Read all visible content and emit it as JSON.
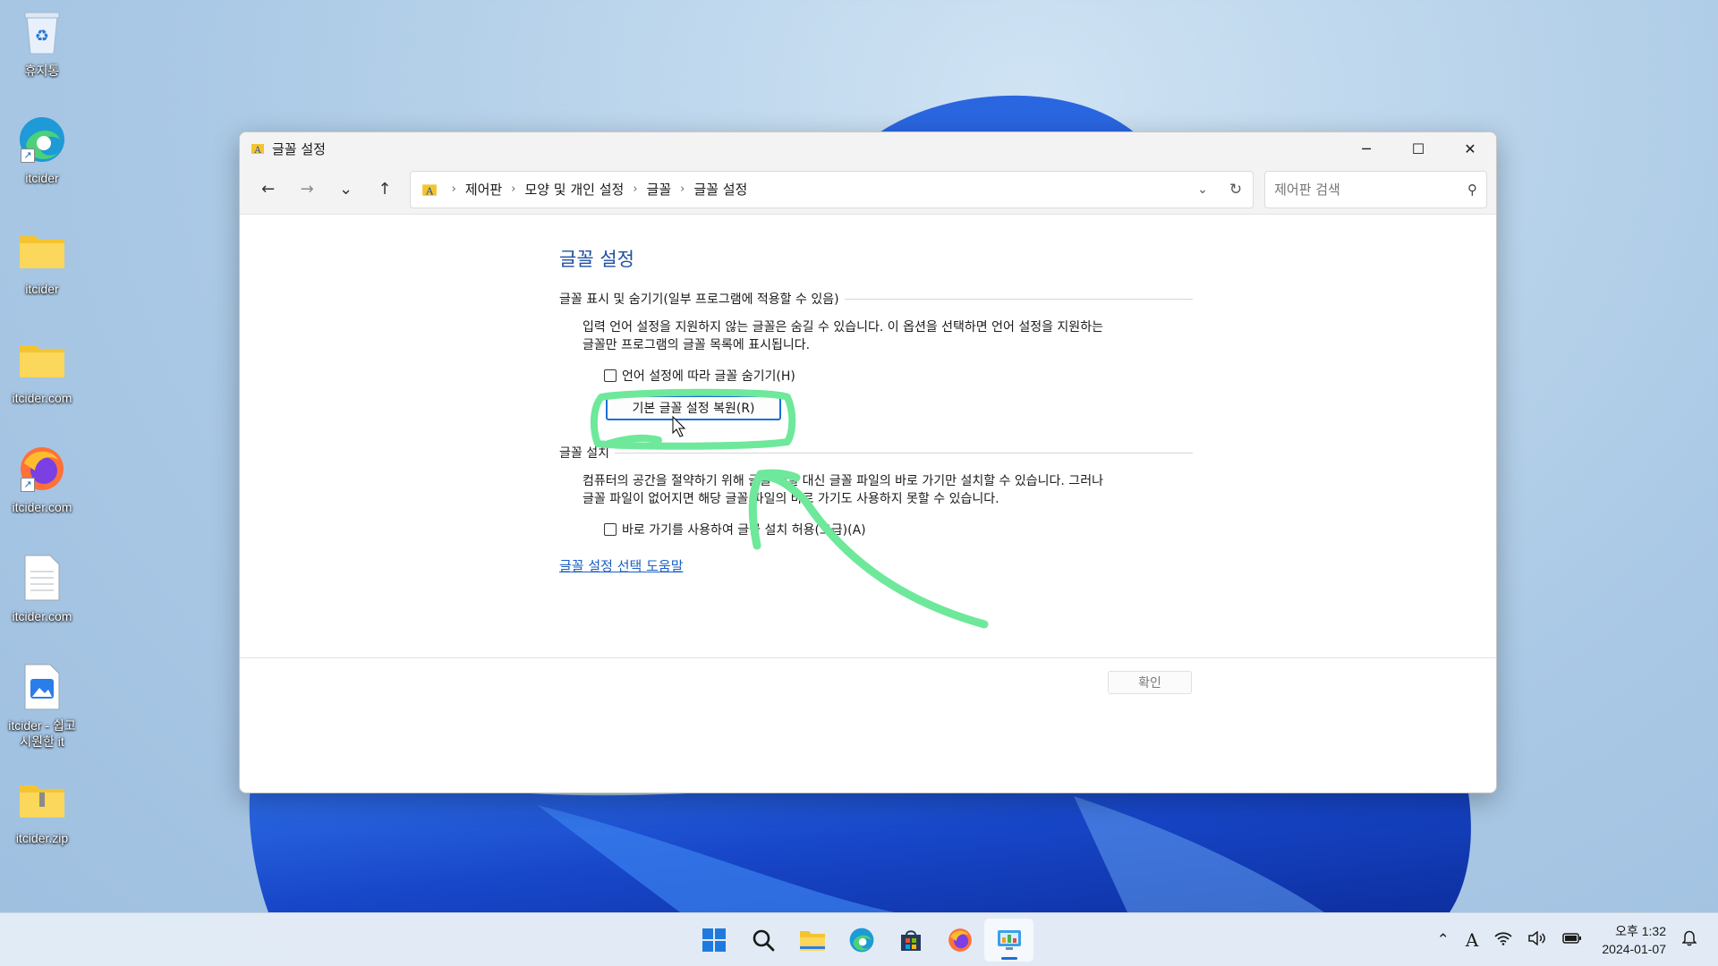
{
  "desktop": {
    "icons": [
      {
        "label": "휴지통",
        "icon": "recycle-bin-icon"
      },
      {
        "label": "itcider",
        "icon": "edge-icon"
      },
      {
        "label": "itcider",
        "icon": "folder-icon"
      },
      {
        "label": "itcider.com",
        "icon": "folder-icon"
      },
      {
        "label": "itcider.com",
        "icon": "firefox-icon"
      },
      {
        "label": "itcider.com",
        "icon": "text-file-icon"
      },
      {
        "label": "itcider - 쉽고 시원한 it",
        "icon": "image-file-icon"
      },
      {
        "label": "itcider.zip",
        "icon": "zip-folder-icon"
      }
    ]
  },
  "window": {
    "title": "글꼴 설정",
    "controls": {
      "minimize": "─",
      "maximize": "☐",
      "close": "✕"
    },
    "nav": {
      "back": "←",
      "forward": "→",
      "recent": "⌄",
      "up": "↑"
    },
    "breadcrumb": [
      "제어판",
      "모양 및 개인 설정",
      "글꼴",
      "글꼴 설정"
    ],
    "search": {
      "placeholder": "제어판 검색"
    },
    "heading": "글꼴 설정",
    "section1": {
      "title": "글꼴 표시 및 숨기기(일부 프로그램에 적용할 수 있음)",
      "desc_line1": "입력 언어 설정을 지원하지 않는 글꼴은 숨길 수 있습니다. 이 옵션을 선택하면 언어 설정을 지원하는",
      "desc_line2": "글꼴만 프로그램의 글꼴 목록에 표시됩니다.",
      "checkbox_label": "언어 설정에 따라 글꼴 숨기기(H)",
      "checked": false,
      "restore_button": "기본 글꼴 설정 복원(R)"
    },
    "section2": {
      "title": "글꼴 설치",
      "desc_line1": "컴퓨터의 공간을 절약하기 위해 글꼴 파일 대신 글꼴 파일의 바로 가기만 설치할 수 있습니다. 그러나",
      "desc_line2": "글꼴 파일이 없어지면 해당 글꼴 파일의 바로 가기도 사용하지 못할 수 있습니다.",
      "checkbox_label": "바로 가기를 사용하여 글꼴 설치 허용(고급)(A)",
      "checked": false
    },
    "help_link": "글꼴 설정 선택 도움말",
    "ok_button": "확인"
  },
  "taskbar": {
    "apps": [
      "windows-start-icon",
      "search-icon",
      "file-explorer-icon",
      "edge-icon",
      "store-icon",
      "firefox-icon",
      "control-panel-icon"
    ],
    "active_app": "control-panel-icon",
    "tray": {
      "ime": "A"
    },
    "clock": {
      "time": "오후 1:32",
      "date": "2024-01-07"
    }
  },
  "colors": {
    "accent": "#1a6fd6",
    "heading": "#1f4fa3",
    "annotation": "#6ee89a"
  }
}
